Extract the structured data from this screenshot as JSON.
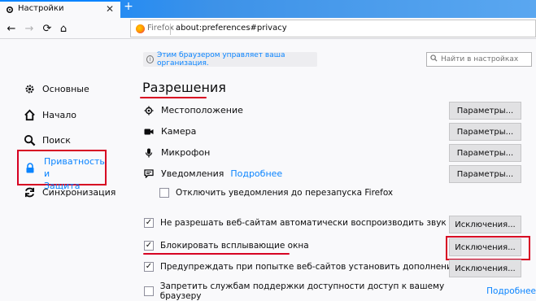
{
  "tab": {
    "title": "Настройки",
    "close": "✕",
    "new_tab": "+"
  },
  "url_bar": {
    "brand": "Firefox",
    "url": "about:preferences#privacy"
  },
  "nav": {
    "back": "←",
    "forward": "→",
    "reload": "⟳",
    "home": "⌂"
  },
  "sidebar": {
    "items": [
      {
        "label": "Основные",
        "icon": "gear-icon"
      },
      {
        "label": "Начало",
        "icon": "home-icon"
      },
      {
        "label": "Поиск",
        "icon": "search-icon"
      },
      {
        "label_line1": "Приватность и",
        "label_line2": "Защита",
        "icon": "lock-icon",
        "active": true
      },
      {
        "label": "Синхронизация",
        "icon": "sync-icon"
      }
    ]
  },
  "org_banner": "Этим браузером управляет ваша организация.",
  "search": {
    "placeholder": "Найти в настройках"
  },
  "section": {
    "title": "Разрешения"
  },
  "permissions": [
    {
      "label": "Местоположение",
      "icon": "location-icon",
      "button": "Параметры..."
    },
    {
      "label": "Камера",
      "icon": "camera-icon",
      "button": "Параметры..."
    },
    {
      "label": "Микрофон",
      "icon": "microphone-icon",
      "button": "Параметры..."
    },
    {
      "label": "Уведомления",
      "link": "Подробнее",
      "icon": "notification-icon",
      "button": "Параметры..."
    }
  ],
  "notif_pause": {
    "label": "Отключить уведомления до перезапуска Firefox",
    "checked": false
  },
  "checkboxes": [
    {
      "label": "Не разрешать веб-сайтам автоматически воспроизводить звук",
      "checked": true,
      "button": "Исключения..."
    },
    {
      "label": "Блокировать всплывающие окна",
      "checked": true,
      "button": "Исключения..."
    },
    {
      "label": "Предупреждать при попытке веб-сайтов установить дополнения",
      "checked": true,
      "button": "Исключения..."
    },
    {
      "label": "Запретить службам поддержки доступности доступ к вашему браузеру",
      "link": "Подробнее",
      "checked": false
    }
  ],
  "colors": {
    "accent": "#0a84ff",
    "highlight": "#d70022",
    "background": "#f9f9fb"
  }
}
